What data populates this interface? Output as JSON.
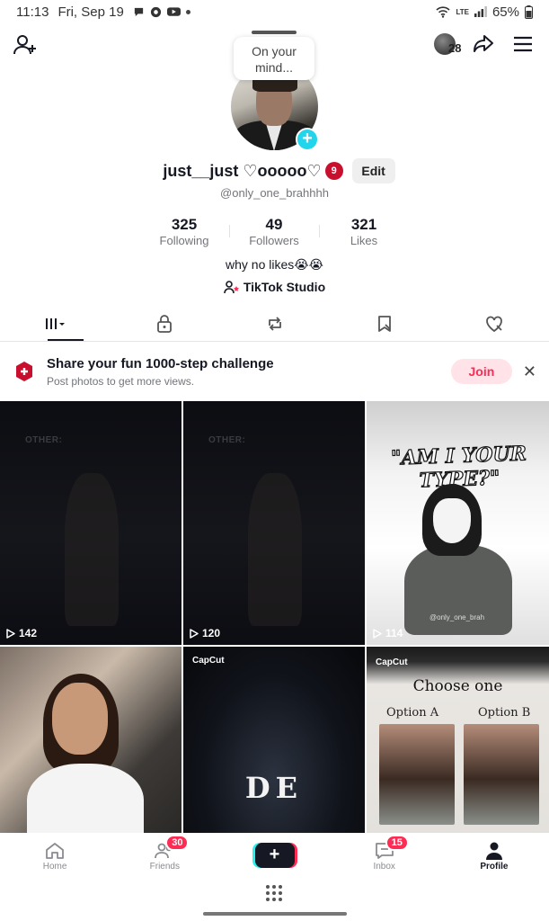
{
  "status_bar": {
    "time": "11:13",
    "date": "Fri, Sep 19",
    "network": "LTE",
    "battery": "65%"
  },
  "header": {
    "following_avatar_count": "28",
    "thought_bubble": "On your mind..."
  },
  "profile": {
    "display_name": "just__just ♡ooooo♡",
    "name_badge": "9",
    "edit_label": "Edit",
    "handle": "@only_one_brahhhh",
    "bio": "why no likes😭😭",
    "studio_label": "TikTok Studio"
  },
  "stats": [
    {
      "value": "325",
      "label": "Following"
    },
    {
      "value": "49",
      "label": "Followers"
    },
    {
      "value": "321",
      "label": "Likes"
    }
  ],
  "tabs": [
    {
      "icon": "videos-grid-icon",
      "active": true
    },
    {
      "icon": "lock-icon",
      "active": false
    },
    {
      "icon": "repost-icon",
      "active": false
    },
    {
      "icon": "bookmark-icon",
      "active": false
    },
    {
      "icon": "liked-heart-icon",
      "active": false
    }
  ],
  "promo": {
    "title": "Share your fun 1000-step challenge",
    "subtitle": "Post photos to get more views.",
    "join_label": "Join",
    "close_glyph": "✕"
  },
  "videos": [
    {
      "views": "142",
      "overlay_text": "OTHER:"
    },
    {
      "views": "120",
      "overlay_text": "OTHER:"
    },
    {
      "views": "114",
      "overlay_text": "\"AM I YOUR TYPE?\"",
      "watermark": "@only_one_brah"
    },
    {
      "views": "",
      "overlay_text": ""
    },
    {
      "views": "",
      "overlay_text": "DE",
      "brand": "CapCut"
    },
    {
      "views": "",
      "overlay_text": "Choose one",
      "option_a": "Option A",
      "option_b": "Option B",
      "brand": "CapCut"
    }
  ],
  "bottom_nav": {
    "home": "Home",
    "friends": "Friends",
    "friends_badge": "30",
    "create_glyph": "+",
    "inbox": "Inbox",
    "inbox_badge": "15",
    "profile": "Profile"
  },
  "colors": {
    "accent": "#fe2c55",
    "cyan": "#25f4ee",
    "text": "#161823",
    "muted": "#73757a"
  }
}
